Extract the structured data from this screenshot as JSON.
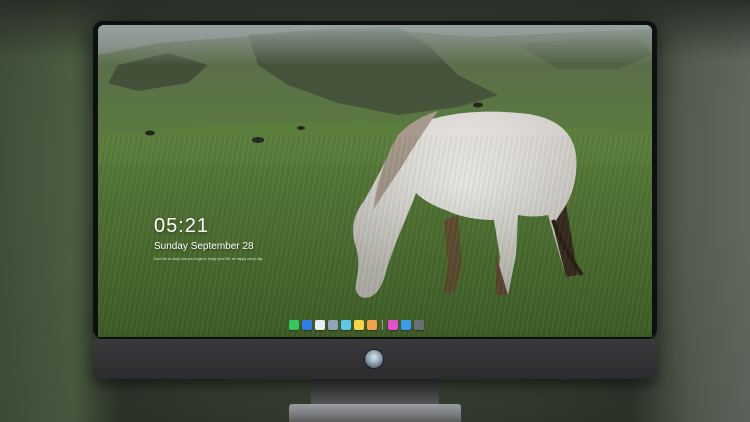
{
  "lock_screen": {
    "time": "05:21",
    "date": "Sunday September 28",
    "note": "Don't be so busy that you forget to enjoy your life, be happy every day."
  },
  "dock": {
    "apps": [
      {
        "name": "messages-icon",
        "glyph": "",
        "color": "#35c759"
      },
      {
        "name": "finder-icon",
        "glyph": "",
        "color": "#2f7fe6"
      },
      {
        "name": "safari-icon",
        "glyph": "",
        "color": "#e9eef3"
      },
      {
        "name": "preview-icon",
        "glyph": "",
        "color": "#8fa6b8"
      },
      {
        "name": "claquette-icon",
        "glyph": "",
        "color": "#5ac8e8"
      },
      {
        "name": "notes-icon",
        "glyph": "",
        "color": "#f5d54b"
      },
      {
        "name": "photos-icon",
        "glyph": "",
        "color": "#f2a34a"
      },
      {
        "name": "itunes-icon",
        "glyph": "",
        "color": "#e84fd0"
      },
      {
        "name": "app-store-icon",
        "glyph": "",
        "color": "#3a9bf0"
      },
      {
        "name": "screenshot-icon",
        "glyph": "",
        "color": "#6b7075"
      }
    ]
  },
  "colors": {
    "clock_text": "#ffffff",
    "monitor_bezel": "#0e0f10",
    "monitor_chin": "#2c2c2e"
  }
}
